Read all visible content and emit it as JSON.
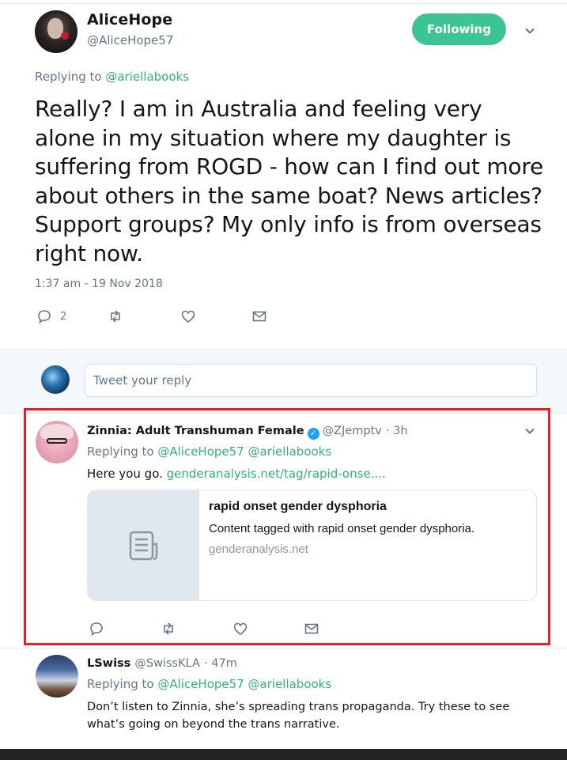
{
  "main_tweet": {
    "author_name": "AliceHope",
    "author_handle": "@AliceHope57",
    "follow_label": "Following",
    "replying_prefix": "Replying to",
    "replying_to": "@ariellabooks",
    "text": "Really? I am in Australia and feeling very alone in my situation where my daughter is suffering from ROGD - how can I find out more about others in the same boat? News articles? Support groups? My only info is from overseas right now.",
    "timestamp": "1:37 am - 19 Nov 2018",
    "reply_count": "2"
  },
  "reply_box": {
    "placeholder": "Tweet your reply"
  },
  "reply1": {
    "name": "Zinnia: Adult Transhuman Female",
    "handle": "@ZJemptv",
    "time": "· 3h",
    "replying_prefix": "Replying to",
    "replying_to_1": "@AliceHope57",
    "replying_to_2": "@ariellabooks",
    "text_prefix": "Here you go.",
    "link": "genderanalysis.net/tag/rapid-onse....",
    "card": {
      "title": "rapid onset gender dysphoria",
      "description": "Content tagged with rapid onset gender dysphoria.",
      "domain": "genderanalysis.net"
    }
  },
  "reply2": {
    "name": "LSwiss",
    "handle": "@SwissKLA",
    "time": "· 47m",
    "replying_prefix": "Replying to",
    "replying_to_1": "@AliceHope57",
    "replying_to_2": "@ariellabooks",
    "text": "Don’t listen to Zinnia, she’s spreading trans propaganda. Try these to see what’s going on beyond the trans narrative."
  },
  "colors": {
    "accent_green": "#3cc592",
    "link_green": "#33b07d",
    "highlight_red": "#e0202a",
    "muted_gray": "#657786"
  },
  "icons": [
    "reply-icon",
    "retweet-icon",
    "like-icon",
    "message-icon",
    "chevron-down-icon",
    "verified-icon",
    "article-icon"
  ]
}
